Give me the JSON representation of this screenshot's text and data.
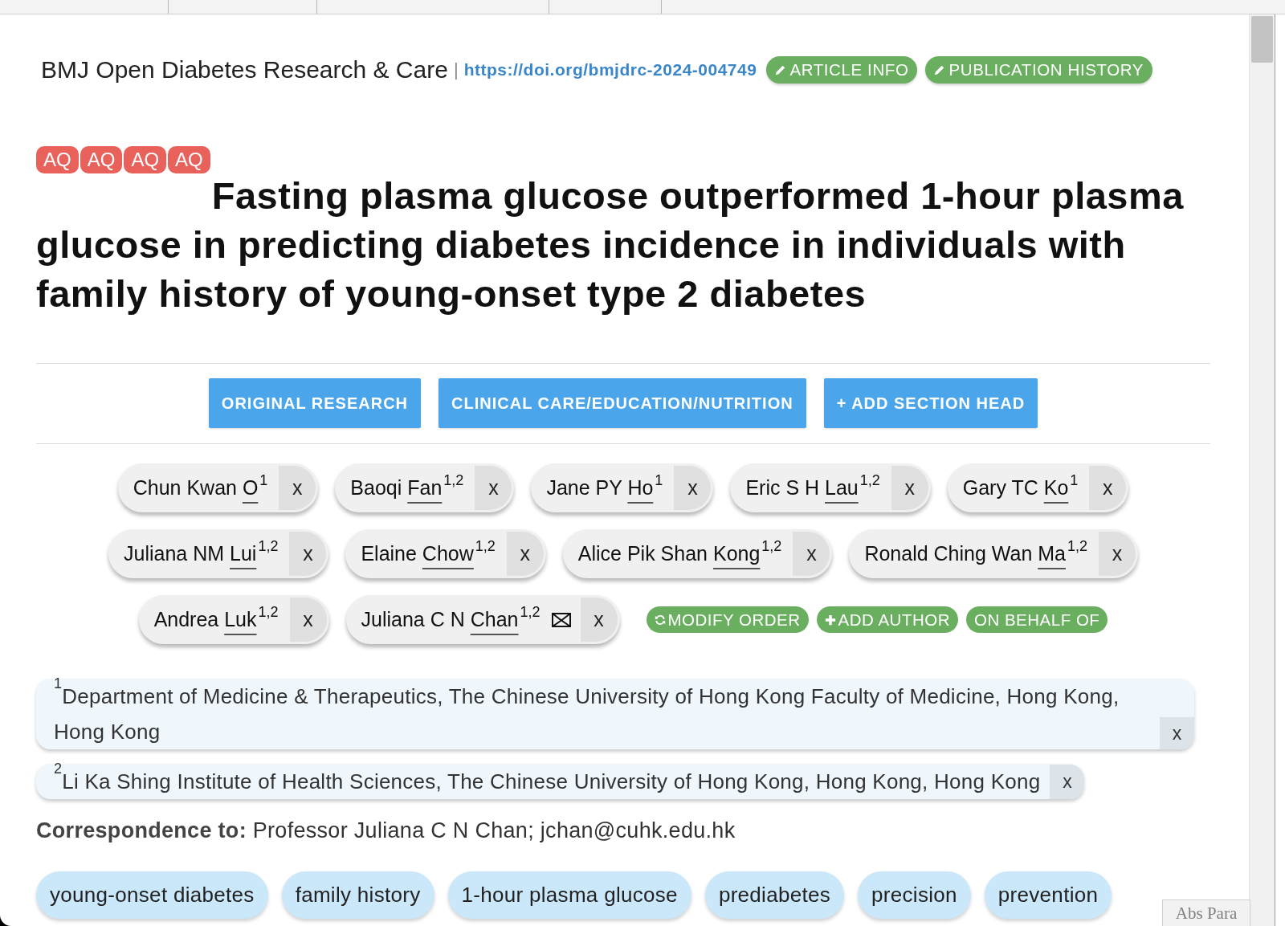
{
  "header": {
    "journal": "BMJ Open Diabetes Research & Care",
    "separator": "|",
    "doi": "https://doi.org/bmjdrc-2024-004749",
    "buttons": [
      "ARTICLE INFO",
      "PUBLICATION HISTORY"
    ]
  },
  "title": {
    "badges": [
      "AQ",
      "AQ",
      "AQ",
      "AQ"
    ],
    "text": "Fasting plasma glucose outperformed 1-hour plasma glucose in predicting diabetes incidence in individuals with family history of young-onset type 2 diabetes"
  },
  "section_heads": [
    "ORIGINAL RESEARCH",
    "CLINICAL CARE/EDUCATION/NUTRITION",
    "+ ADD SECTION HEAD"
  ],
  "authors": [
    {
      "given": "Chun Kwan",
      "surname": "O",
      "affiliations": "1",
      "corresponding": false,
      "remove": "x"
    },
    {
      "given": "Baoqi",
      "surname": "Fan",
      "affiliations": "1,2",
      "corresponding": false,
      "remove": "x"
    },
    {
      "given": "Jane PY",
      "surname": "Ho",
      "affiliations": "1",
      "corresponding": false,
      "remove": "x"
    },
    {
      "given": "Eric S H",
      "surname": "Lau",
      "affiliations": "1,2",
      "corresponding": false,
      "remove": "x"
    },
    {
      "given": "Gary TC",
      "surname": "Ko",
      "affiliations": "1",
      "corresponding": false,
      "remove": "x"
    },
    {
      "given": "Juliana NM",
      "surname": "Lui",
      "affiliations": "1,2",
      "corresponding": false,
      "remove": "x"
    },
    {
      "given": "Elaine",
      "surname": "Chow",
      "affiliations": "1,2",
      "corresponding": false,
      "remove": "x"
    },
    {
      "given": "Alice Pik Shan",
      "surname": "Kong",
      "affiliations": "1,2",
      "corresponding": false,
      "remove": "x"
    },
    {
      "given": "Ronald Ching Wan",
      "surname": "Ma",
      "affiliations": "1,2",
      "corresponding": false,
      "remove": "x"
    },
    {
      "given": "Andrea",
      "surname": "Luk",
      "affiliations": "1,2",
      "corresponding": false,
      "remove": "x"
    },
    {
      "given": "Juliana C N",
      "surname": "Chan",
      "affiliations": "1,2",
      "corresponding": true,
      "remove": "x"
    }
  ],
  "author_actions": [
    {
      "label": "MODIFY ORDER",
      "kind": "reorder"
    },
    {
      "label": "ADD AUTHOR",
      "kind": "add"
    },
    {
      "label": "ON BEHALF OF",
      "kind": "plain"
    }
  ],
  "affiliations": [
    {
      "number": "1",
      "text": "Department of Medicine & Therapeutics, The Chinese University of Hong Kong Faculty of Medicine, Hong Kong, Hong Kong",
      "remove": "x"
    },
    {
      "number": "2",
      "text": "Li Ka Shing Institute of Health Sciences, The Chinese University of Hong Kong, Hong Kong, Hong Kong",
      "remove": "x"
    }
  ],
  "correspondence": "**Correspondence to:** Professor Juliana C N Chan; jchan@cuhk.edu.hk",
  "keywords": [
    "young-onset diabetes",
    "family history",
    "1-hour plasma glucose",
    "prediabetes",
    "precision",
    "prevention"
  ],
  "style_label": "Abs Para"
}
